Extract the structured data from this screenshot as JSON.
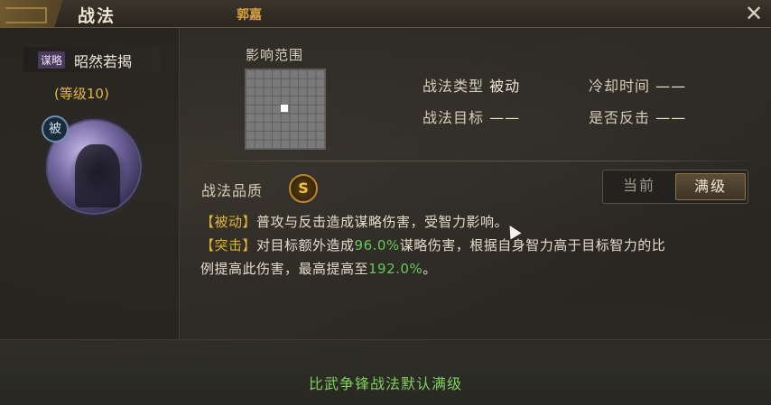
{
  "header": {
    "title": "战法",
    "hero_name": "郭嘉",
    "close_icon": "close-icon"
  },
  "skill": {
    "type_tag": "谋略",
    "name": "昭然若揭",
    "level": "(等级10)",
    "passive_badge": "被",
    "portrait_icon": "skill-portrait"
  },
  "range": {
    "label": "影响范围",
    "grid_size": 9
  },
  "attributes": {
    "type_label": "战法类型",
    "type_value": "被动",
    "cooldown_label": "冷却时间",
    "cooldown_value": "——",
    "target_label": "战法目标",
    "target_value": "——",
    "counter_label": "是否反击",
    "counter_value": "——"
  },
  "quality": {
    "label": "战法品质",
    "grade": "S"
  },
  "toggle": {
    "current": "当前",
    "max": "满级",
    "selected": "满级"
  },
  "description": {
    "line1_tag": "【被动】",
    "line1_text": "普攻与反击造成谋略伤害，受智力影响。",
    "line2_tag": "【突击】",
    "line2_text_a": "对目标额外造成",
    "line2_num": "96.0%",
    "line2_text_b": "谋略伤害，根据自身智力高于目标智力的比",
    "line3_text_a": "例提高此伤害，最高提高至",
    "line3_num": "192.0%",
    "line3_text_b": "。"
  },
  "footer": {
    "note": "比武争锋战法默认满级"
  },
  "colors": {
    "accent_gold": "#e0b240",
    "highlight_green": "#65c85f",
    "footer_green": "#7fcf5e",
    "strategy_tag_bg": "#4a3a5c"
  }
}
